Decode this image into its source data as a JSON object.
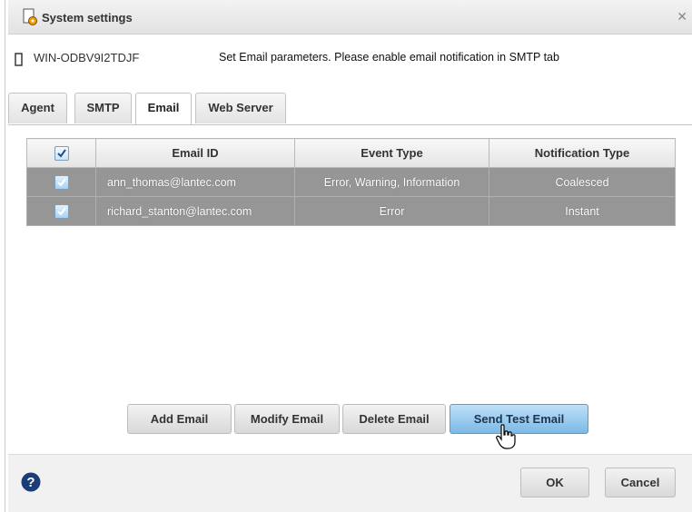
{
  "window": {
    "title": "System settings",
    "close_icon": "close-icon"
  },
  "host": {
    "name": "WIN-ODBV9I2TDJF",
    "message": "Set Email parameters. Please enable email notification in SMTP tab"
  },
  "tabs": [
    {
      "label": "Agent",
      "active": false
    },
    {
      "label": "SMTP",
      "active": false
    },
    {
      "label": "Email",
      "active": true
    },
    {
      "label": "Web Server",
      "active": false
    }
  ],
  "grid": {
    "columns": [
      "Email ID",
      "Event Type",
      "Notification Type"
    ],
    "header_checked": true,
    "rows": [
      {
        "checked": true,
        "email": "ann_thomas@lantec.com",
        "event": "Error, Warning, Information",
        "notification": "Coalesced"
      },
      {
        "checked": true,
        "email": "richard_stanton@lantec.com",
        "event": "Error",
        "notification": "Instant"
      }
    ]
  },
  "buttons": {
    "add": "Add Email",
    "modify": "Modify Email",
    "delete": "Delete Email",
    "send_test": "Send Test Email",
    "ok": "OK",
    "cancel": "Cancel"
  },
  "colors": {
    "row_bg": "#969696",
    "primary_button": "#7cb9e6",
    "help_icon": "#1a3c78"
  }
}
